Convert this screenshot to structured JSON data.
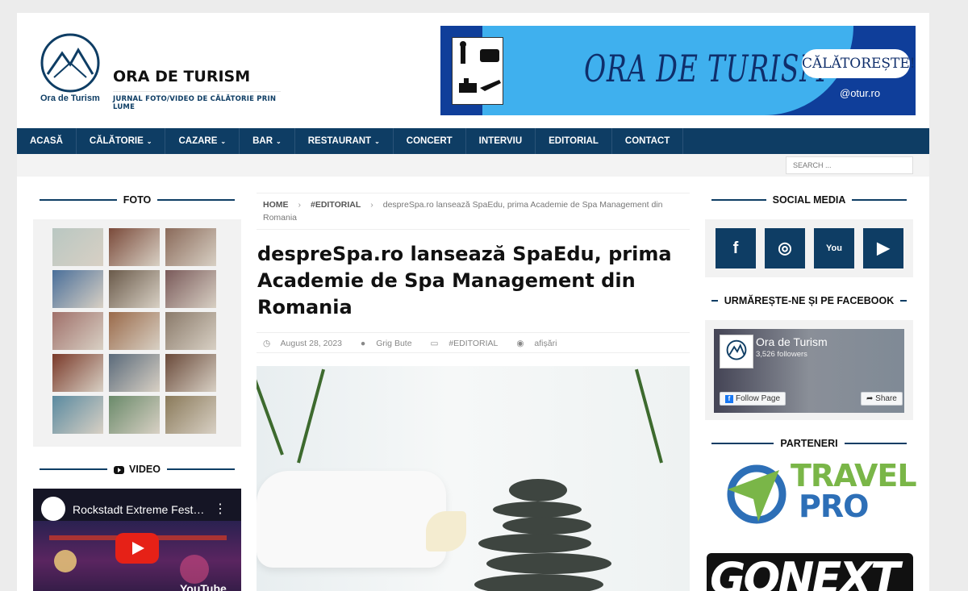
{
  "header": {
    "logo_text": "Ora de Turism",
    "site_title": "ORA DE TURISM",
    "tagline": "JURNAL FOTO/VIDEO DE CĂLĂTORIE PRIN LUME",
    "banner": {
      "title": "ORA DE TURISM",
      "cta": "CĂLĂTOREȘTE!",
      "handle": "@otur.ro",
      "colors": {
        "dark": "#0f3e9a",
        "light": "#3fb0ee"
      }
    }
  },
  "nav": {
    "items": [
      {
        "label": "ACASĂ",
        "dropdown": false
      },
      {
        "label": "CĂLĂTORIE",
        "dropdown": true
      },
      {
        "label": "CAZARE",
        "dropdown": true
      },
      {
        "label": "BAR",
        "dropdown": true
      },
      {
        "label": "RESTAURANT",
        "dropdown": true
      },
      {
        "label": "CONCERT",
        "dropdown": false
      },
      {
        "label": "INTERVIU",
        "dropdown": false
      },
      {
        "label": "EDITORIAL",
        "dropdown": false
      },
      {
        "label": "CONTACT",
        "dropdown": false
      }
    ],
    "chevron": "⌄",
    "search_placeholder": "SEARCH ...",
    "color": "#0e3d64"
  },
  "left_sidebar": {
    "foto_heading": "FOTO",
    "video_heading": "VIDEO",
    "video": {
      "title": "Rockstadt Extreme Fest…",
      "more": "⋮",
      "brand": "YouTube"
    }
  },
  "breadcrumb": {
    "home": "HOME",
    "category": "#EDITORIAL",
    "current": "despreSpa.ro lansează SpaEdu, prima Academie de Spa Management din Romania",
    "separator": "›"
  },
  "article": {
    "title": "despreSpa.ro lansează SpaEdu, prima Academie de Spa Management din Romania",
    "meta": {
      "date": "August 28, 2023",
      "author": "Grig Bute",
      "category": "#EDITORIAL",
      "views": "afișări"
    }
  },
  "right_sidebar": {
    "social_heading": "SOCIAL MEDIA",
    "social": [
      {
        "icon": "facebook-icon",
        "glyph": "f"
      },
      {
        "icon": "instagram-icon",
        "glyph": "◎"
      },
      {
        "icon": "youtube-icon",
        "glyph": "You"
      },
      {
        "icon": "play-icon",
        "glyph": "▶"
      }
    ],
    "facebook_heading": "URMĂREȘTE-NE ȘI PE FACEBOOK",
    "facebook": {
      "page_name": "Ora de Turism",
      "followers": "3,526 followers",
      "follow_label": "Follow Page",
      "share_label": "Share"
    },
    "partners_heading": "PARTENERI",
    "partners": [
      {
        "line1": "TRAVEL",
        "line2": "PRO"
      },
      {
        "line1": "GONEXT"
      }
    ]
  }
}
